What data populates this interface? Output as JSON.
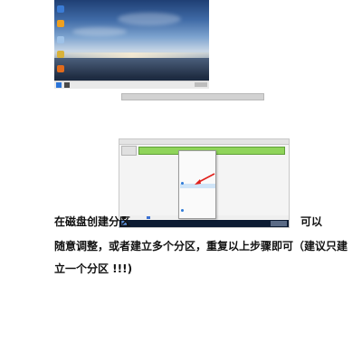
{
  "desktop": {
    "icons": [
      {
        "name": "recycle-bin-icon",
        "color": "#3a7bd5"
      },
      {
        "name": "browser-icon",
        "color": "#f0a01e"
      },
      {
        "name": "folder-icon",
        "color": "#9ec2e8"
      },
      {
        "name": "settings-icon",
        "color": "#d9b23a"
      },
      {
        "name": "app-icon",
        "color": "#e06b1c"
      }
    ]
  },
  "strip": {
    "items": [
      "",
      "",
      "",
      "",
      "",
      ""
    ]
  },
  "disk_management": {
    "disk_label": "",
    "unallocated_label": "",
    "context_menu": {
      "items": [
        "",
        "",
        "",
        "",
        "",
        "",
        "",
        "",
        "",
        "",
        "",
        "",
        "",
        ""
      ],
      "highlighted_index": 6
    },
    "legend": {
      "unallocated_color": "#1a1a1a",
      "primary_color": "#3a6fd1"
    }
  },
  "paragraph": {
    "line1_start": "在磁盘创建分区",
    "line1_end": "可以",
    "line2": "随意调整，或者建立多个分区，重复以上步骤即可（建议只建",
    "line3": "立一个分区 !!!)"
  }
}
